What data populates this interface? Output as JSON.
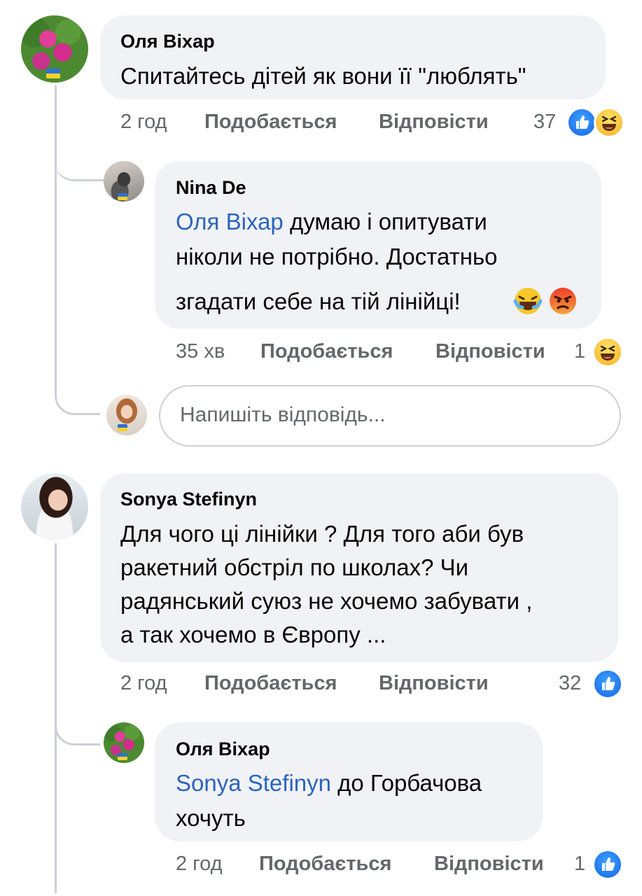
{
  "comments": [
    {
      "author": "Оля Віхар",
      "text": "Спитайтесь дітей як вони її \"люблять\"",
      "time": "2 год",
      "like_label": "Подобається",
      "reply_label": "Відповісти",
      "reaction_count": "37",
      "reactions": [
        "like-icon",
        "haha-icon"
      ],
      "replies": [
        {
          "author": "Nina De",
          "mention": "Оля Віхар",
          "text_line1": " думаю і опитувати",
          "text_line2": "ніколи не потрібно. Достатньо",
          "text_line3": "згадати себе на тій лінійці!",
          "emojis": [
            "laughing-crying-emoji",
            "angry-face-emoji"
          ],
          "time": "35 хв",
          "like_label": "Подобається",
          "reply_label": "Відповісти",
          "reaction_count": "1",
          "reactions": [
            "haha-icon"
          ]
        }
      ],
      "reply_input_placeholder": "Напишіть відповідь..."
    },
    {
      "author": "Sonya Stefinyn",
      "text_line1": "Для чого ці лінійки ? Для того аби був",
      "text_line2": "ракетний обстріл по школах? Чи",
      "text_line3": "радянський суюз не хочемо забувати ,",
      "text_line4": "а так хочемо в Європу ...",
      "time": "2 год",
      "like_label": "Подобається",
      "reply_label": "Відповісти",
      "reaction_count": "32",
      "reactions": [
        "like-icon"
      ],
      "replies": [
        {
          "author": "Оля Віхар",
          "mention": "Sonya Stefinyn",
          "text_line1": " до Горбачова",
          "text_line2": "хочуть",
          "time": "2 год",
          "like_label": "Подобається",
          "reply_label": "Відповісти",
          "reaction_count": "1",
          "reactions": [
            "like-icon"
          ]
        }
      ]
    }
  ],
  "colors": {
    "bubble": "#f0f2f5",
    "mention": "#2d64bc",
    "meta": "#65676b",
    "thread_line": "#ced0d4",
    "like_blue": "#1877f2",
    "haha_yellow": "#f7b125"
  }
}
